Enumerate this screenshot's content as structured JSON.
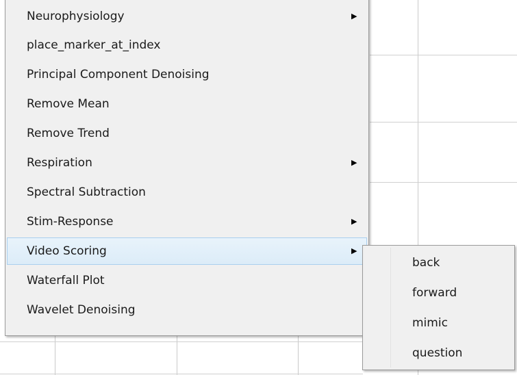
{
  "menu": {
    "items": [
      {
        "label": "Neurophysiology",
        "has_submenu": true
      },
      {
        "label": "place_marker_at_index",
        "has_submenu": false
      },
      {
        "label": "Principal Component Denoising",
        "has_submenu": false
      },
      {
        "label": "Remove Mean",
        "has_submenu": false
      },
      {
        "label": "Remove Trend",
        "has_submenu": false
      },
      {
        "label": "Respiration",
        "has_submenu": true
      },
      {
        "label": "Spectral Subtraction",
        "has_submenu": false
      },
      {
        "label": "Stim-Response",
        "has_submenu": true
      },
      {
        "label": "Video Scoring",
        "has_submenu": true,
        "highlighted": true
      },
      {
        "label": "Waterfall Plot",
        "has_submenu": false
      },
      {
        "label": "Wavelet Denoising",
        "has_submenu": false
      }
    ],
    "submenu_arrow_icon": "triangle-right-icon",
    "highlight_color": "#dcecf8",
    "highlight_border": "#a9cfee"
  },
  "submenu": {
    "parent": "Video Scoring",
    "items": [
      {
        "label": "back"
      },
      {
        "label": "forward"
      },
      {
        "label": "mimic"
      },
      {
        "label": "question"
      }
    ]
  }
}
